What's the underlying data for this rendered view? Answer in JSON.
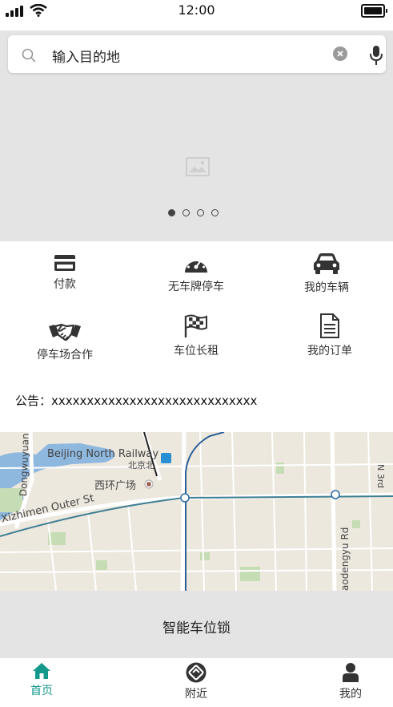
{
  "status_bar": {
    "time": "12:00"
  },
  "search": {
    "placeholder": "输入目的地"
  },
  "banner": {
    "page_count": 4,
    "active_index": 0
  },
  "menu": [
    {
      "label": "付款",
      "icon": "credit-card-icon"
    },
    {
      "label": "无车牌停车",
      "icon": "speedometer-icon"
    },
    {
      "label": "我的车辆",
      "icon": "car-icon"
    },
    {
      "label": "停车场合作",
      "icon": "handshake-icon"
    },
    {
      "label": "车位长租",
      "icon": "flag-icon"
    },
    {
      "label": "我的订单",
      "icon": "document-icon"
    }
  ],
  "notice": {
    "text": "公告：xxxxxxxxxxxxxxxxxxxxxxxxxxxxx"
  },
  "map": {
    "labels": [
      "Beijing North Railway",
      "北京北",
      "西环广场",
      "Xizhimen Outer St",
      "Dongwuyuan R",
      "aodengyu Rd",
      "N 3rd"
    ]
  },
  "smart_lock": {
    "label": "智能车位锁"
  },
  "tabs": [
    {
      "label": "首页",
      "icon": "home-icon",
      "active": true
    },
    {
      "label": "附近",
      "icon": "nearby-icon",
      "active": false
    },
    {
      "label": "我的",
      "icon": "user-icon",
      "active": false
    }
  ],
  "colors": {
    "accent": "#13998c",
    "banner_bg": "#e4e4e4"
  }
}
